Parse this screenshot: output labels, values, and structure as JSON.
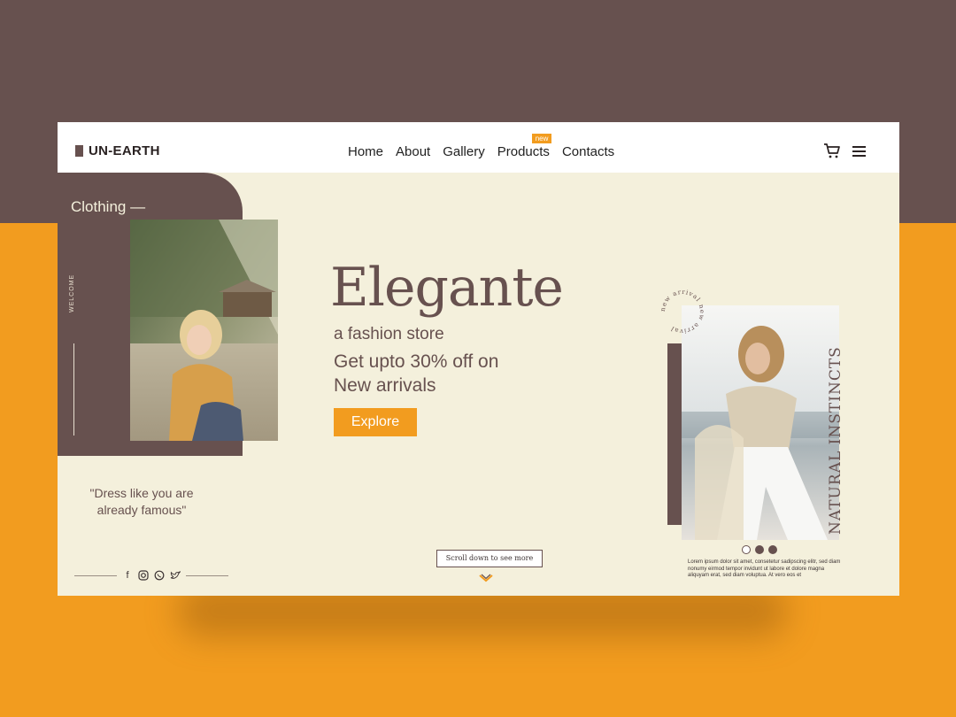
{
  "brand": {
    "name": "UN-EARTH"
  },
  "nav": {
    "items": [
      {
        "label": "Home"
      },
      {
        "label": "About"
      },
      {
        "label": "Gallery"
      },
      {
        "label": "Products",
        "badge": "new"
      },
      {
        "label": "Contacts"
      }
    ]
  },
  "header_icons": [
    "cart-icon",
    "menu-icon"
  ],
  "left": {
    "category": "Clothing —",
    "welcome": "WELCOME",
    "quote_line1": "\"Dress like you are",
    "quote_line2": "already famous\""
  },
  "social_icons": [
    "facebook-icon",
    "instagram-icon",
    "whatsapp-icon",
    "twitter-icon"
  ],
  "hero": {
    "title": "Elegante",
    "subtitle": "a fashion store",
    "offer_line1": "Get upto 30% off on",
    "offer_line2": "New arrivals",
    "cta": "Explore"
  },
  "scroll": {
    "label": "Scroll down to see more"
  },
  "right": {
    "circle_text": "new arrival new arrival",
    "vertical_text": "NATURAL INSTINCTS",
    "slides": {
      "count": 3,
      "active": 1
    },
    "description": "Lorem ipsum dolor sit amet, consetetur sadipscing elitr, sed diam nonumy eirmod tempor invidunt ut labore et dolore magna aliquyam erat, sed diam voluptua. At vero eos et"
  },
  "colors": {
    "brown": "#67514f",
    "orange": "#f29c1f",
    "cream": "#f4f0dc",
    "white": "#ffffff"
  }
}
